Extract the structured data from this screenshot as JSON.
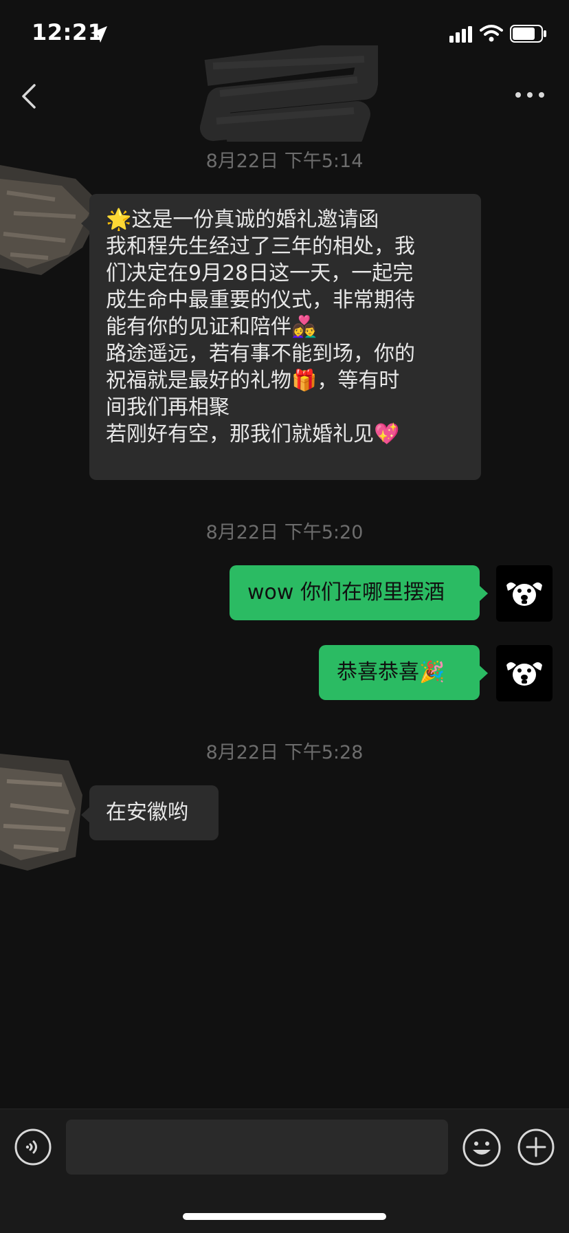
{
  "status_bar": {
    "time": "12:21",
    "icons": [
      "location-arrow-icon",
      "cellular-signal-icon",
      "wifi-icon",
      "battery-icon"
    ]
  },
  "nav": {
    "back_icon": "chevron-left-icon",
    "more_icon": "ellipsis-icon"
  },
  "messages": {
    "timestamp_1": "8月22日 下午5:14",
    "invite": {
      "line1": "🌟这是一份真诚的婚礼邀请函",
      "line2": "我和程先生经过了三年的相处，我",
      "line3": "们决定在9月28日这一天，一起完",
      "line4": "成生命中最重要的仪式，非常期待",
      "line5": "能有你的见证和陪伴👩‍❤️‍👨",
      "line6": "路途遥远，若有事不能到场，你的",
      "line7": "祝福就是最好的礼物🎁，等有时",
      "line8": "间我们再相聚",
      "line9": "若刚好有空，那我们就婚礼见💖"
    },
    "timestamp_2": "8月22日 下午5:20",
    "sent_1": "wow 你们在哪里摆酒",
    "sent_2": "恭喜恭喜🎉",
    "timestamp_3": "8月22日 下午5:28",
    "reply": "在安徽哟"
  },
  "input_bar": {
    "value": "",
    "icons": [
      "voice-icon",
      "emoji-face-icon",
      "plus-icon"
    ]
  },
  "colors": {
    "background": "#111111",
    "incoming_bubble": "#2c2c2c",
    "outgoing_bubble": "#2bbb63",
    "timestamp": "#6d6d6d"
  }
}
